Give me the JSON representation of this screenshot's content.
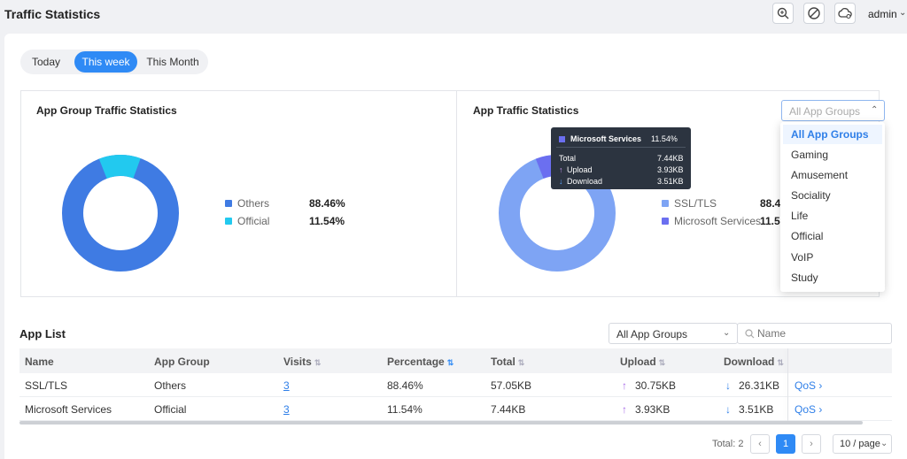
{
  "header": {
    "title": "Traffic Statistics",
    "user": "admin",
    "icons": [
      "search-zoom-icon",
      "block-icon",
      "cloud-settings-icon"
    ]
  },
  "period_tabs": [
    {
      "label": "Today",
      "active": false
    },
    {
      "label": "This week",
      "active": true
    },
    {
      "label": "This Month",
      "active": false
    }
  ],
  "group_panel": {
    "title": "App Group Traffic Statistics",
    "legend": [
      {
        "name": "Others",
        "value": "88.46%",
        "color": "#3f7be3"
      },
      {
        "name": "Official",
        "value": "11.54%",
        "color": "#22c9ef"
      }
    ]
  },
  "app_panel": {
    "title": "App Traffic Statistics",
    "select_placeholder": "All App Groups",
    "legend": [
      {
        "name": "SSL/TLS",
        "value": "88.46%",
        "color": "#7ea4f4"
      },
      {
        "name": "Microsoft Services",
        "value": "11.54%",
        "color": "#6b6ff0"
      }
    ],
    "dropdown": [
      "All App Groups",
      "Gaming",
      "Amusement",
      "Sociality",
      "Life",
      "Official",
      "VoIP",
      "Study"
    ],
    "tooltip": {
      "name": "Microsoft Services",
      "percent": "11.54%",
      "rows": [
        {
          "label": "Total",
          "value": "7.44KB"
        },
        {
          "label": "Upload",
          "value": "3.93KB"
        },
        {
          "label": "Download",
          "value": "3.51KB"
        }
      ]
    }
  },
  "app_list": {
    "title": "App List",
    "group_filter": "All App Groups",
    "search_placeholder": "Name",
    "columns": [
      "Name",
      "App Group",
      "Visits",
      "Percentage",
      "Total",
      "Upload",
      "Download"
    ],
    "rows": [
      {
        "name": "SSL/TLS",
        "group": "Others",
        "visits": "3",
        "percentage": "88.46%",
        "total": "57.05KB",
        "upload": "30.75KB",
        "download": "26.31KB",
        "action": "QoS"
      },
      {
        "name": "Microsoft Services",
        "group": "Official",
        "visits": "3",
        "percentage": "11.54%",
        "total": "7.44KB",
        "upload": "3.93KB",
        "download": "3.51KB",
        "action": "QoS"
      }
    ]
  },
  "pagination": {
    "total": "Total: 2",
    "page": "1",
    "page_size": "10 / page"
  },
  "colors": {
    "accent": "#2f8af5",
    "upload_arrow": "#a86be8",
    "download_arrow": "#2f7fe8"
  }
}
